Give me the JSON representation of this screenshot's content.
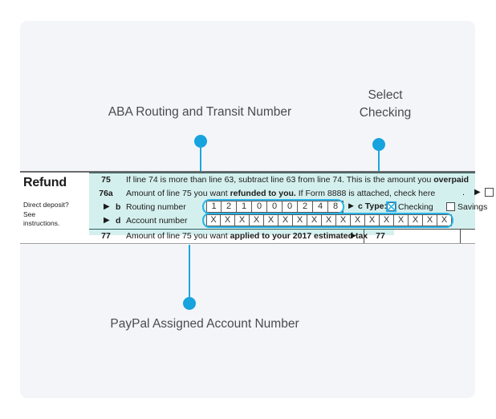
{
  "document": {
    "title": "IRS Form 1040 Refund / Direct Deposit section with annotations"
  },
  "callouts": [
    {
      "id": "aba",
      "text": "ABA Routing and Transit Number",
      "dot_color": "#17a3de",
      "line_color": "#1ba7e0"
    },
    {
      "id": "checking",
      "text": "Select\nChecking",
      "dot_color": "#17a3de",
      "line_color": "#1ba7e0"
    },
    {
      "id": "account",
      "text": "PayPal Assigned Account Number",
      "dot_color": "#17a3de",
      "line_color": "#1ba7e0"
    }
  ],
  "form": {
    "section_label": "Refund",
    "direct_deposit_note": "Direct deposit?\nSee\ninstructions.",
    "shade_color": "#d4f0ee",
    "highlight_color": "#2bb3e8",
    "rows": {
      "line75": {
        "number": "75",
        "text_pre": "If line 74 is more than line 63, subtract line 63 from line 74. This is the amount you ",
        "text_bold": "overpaid"
      },
      "line76a": {
        "number": "76a",
        "text_pre": "Amount of line 75 you want ",
        "text_bold": "refunded to you.",
        "text_post": " If Form 8888 is attached, check here",
        "dot": ".",
        "arrow": "▶",
        "checkbox_checked": false
      },
      "lineb": {
        "arrow": "▶",
        "letter": "b",
        "label": "Routing number",
        "digits": [
          "1",
          "2",
          "1",
          "0",
          "0",
          "0",
          "2",
          "4",
          "8"
        ]
      },
      "type": {
        "arrow": "▶",
        "label": "c Type:",
        "checking_label": "Checking",
        "checking_checked": true,
        "savings_label": "Savings",
        "savings_checked": false
      },
      "lined": {
        "arrow": "▶",
        "letter": "d",
        "label": "Account number",
        "digits": [
          "X",
          "X",
          "X",
          "X",
          "X",
          "X",
          "X",
          "X",
          "X",
          "X",
          "X",
          "X",
          "X",
          "X",
          "X",
          "X",
          "X"
        ]
      },
      "line77": {
        "number": "77",
        "text_pre": "Amount of line 75 you want ",
        "text_bold": "applied to your 2017 estimated tax",
        "arrow": "▶",
        "box_number": "77",
        "amount_value": ""
      }
    }
  }
}
